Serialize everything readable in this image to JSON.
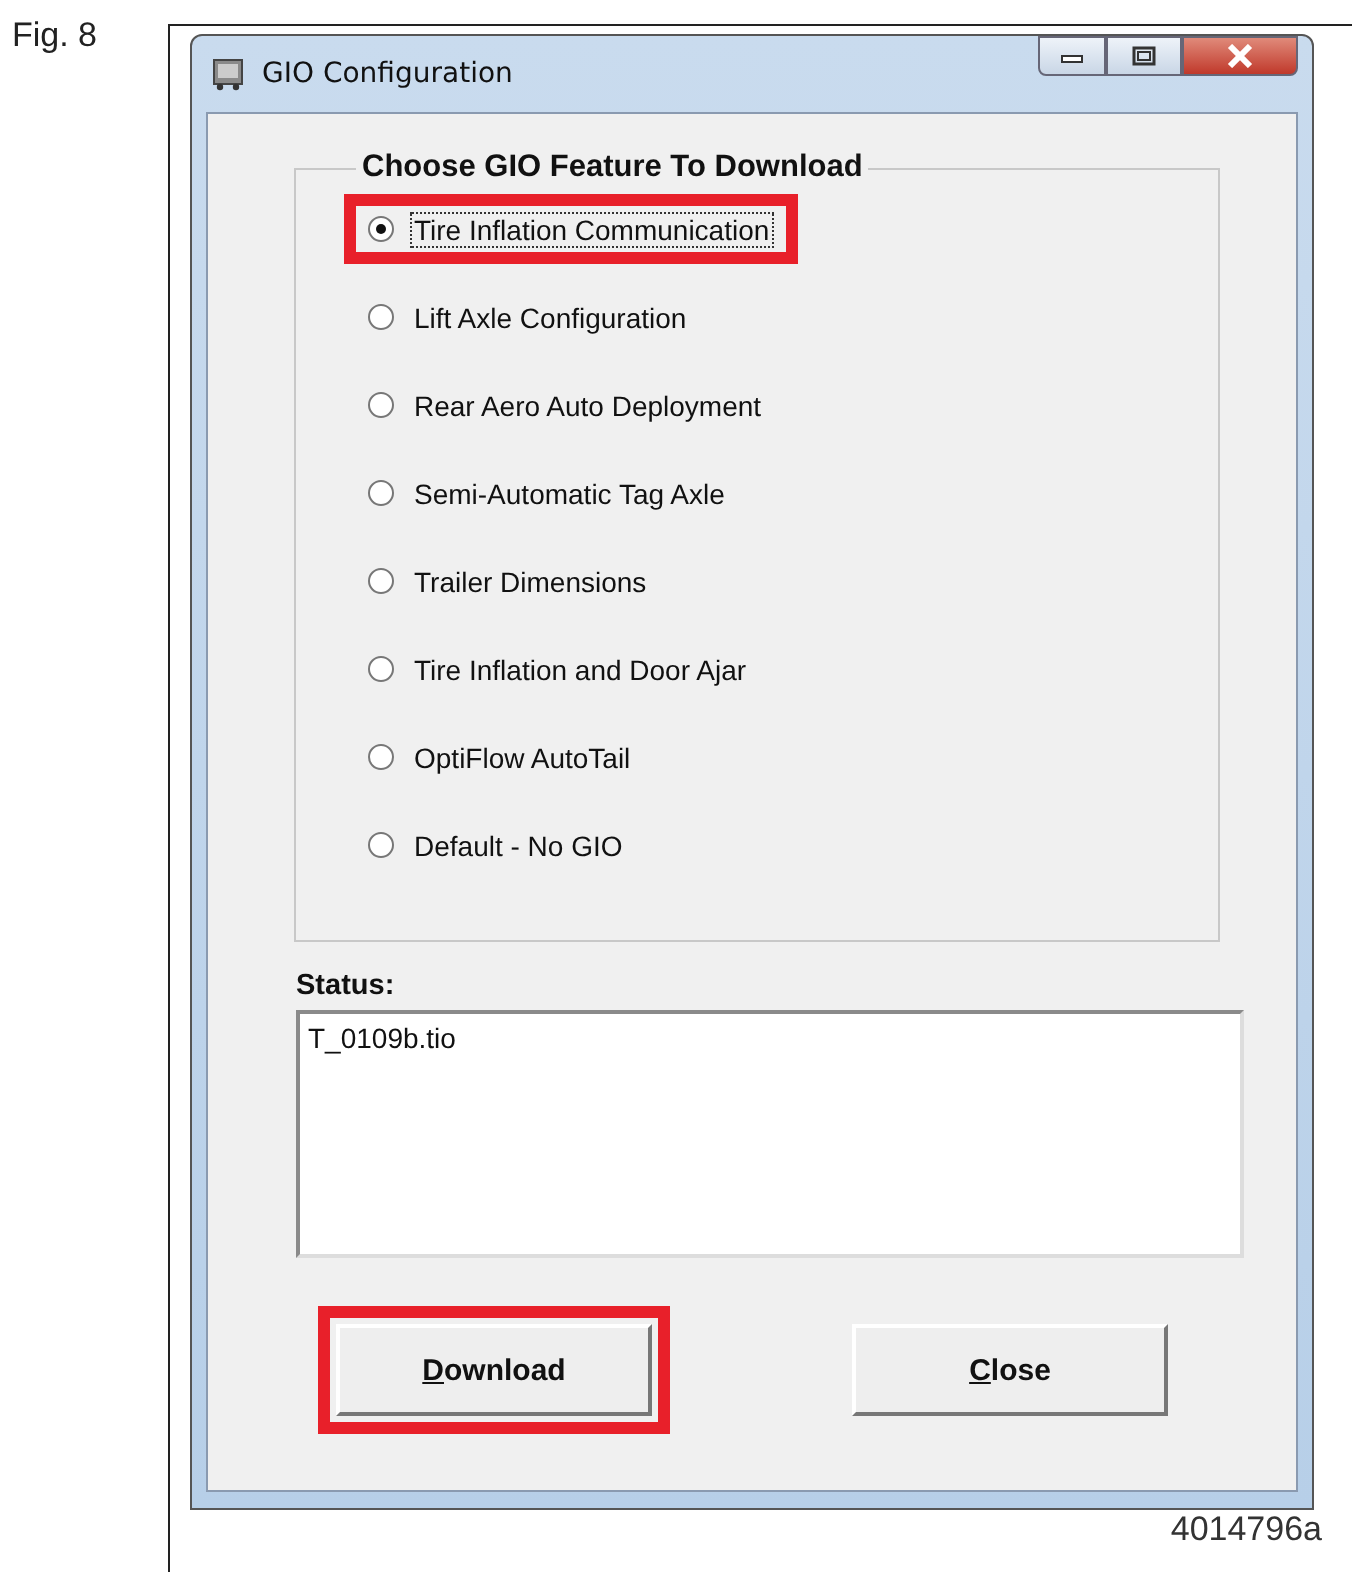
{
  "figure": {
    "label": "Fig. 8",
    "caption": "4014796a"
  },
  "window": {
    "title": "GIO Configuration"
  },
  "feature_group": {
    "title": "Choose GIO Feature To Download",
    "options": [
      {
        "label": "Tire Inflation Communication",
        "selected": true,
        "highlighted": true
      },
      {
        "label": "Lift Axle Configuration",
        "selected": false,
        "highlighted": false
      },
      {
        "label": "Rear Aero Auto Deployment",
        "selected": false,
        "highlighted": false
      },
      {
        "label": "Semi-Automatic Tag Axle",
        "selected": false,
        "highlighted": false
      },
      {
        "label": "Trailer Dimensions",
        "selected": false,
        "highlighted": false
      },
      {
        "label": "Tire Inflation and Door Ajar",
        "selected": false,
        "highlighted": false
      },
      {
        "label": "OptiFlow AutoTail",
        "selected": false,
        "highlighted": false
      },
      {
        "label": "Default - No GIO",
        "selected": false,
        "highlighted": false
      }
    ]
  },
  "status": {
    "label": "Status:",
    "value": "T_0109b.tio"
  },
  "buttons": [
    {
      "label": "Download",
      "highlighted": true
    },
    {
      "label": "Close",
      "highlighted": false
    }
  ]
}
